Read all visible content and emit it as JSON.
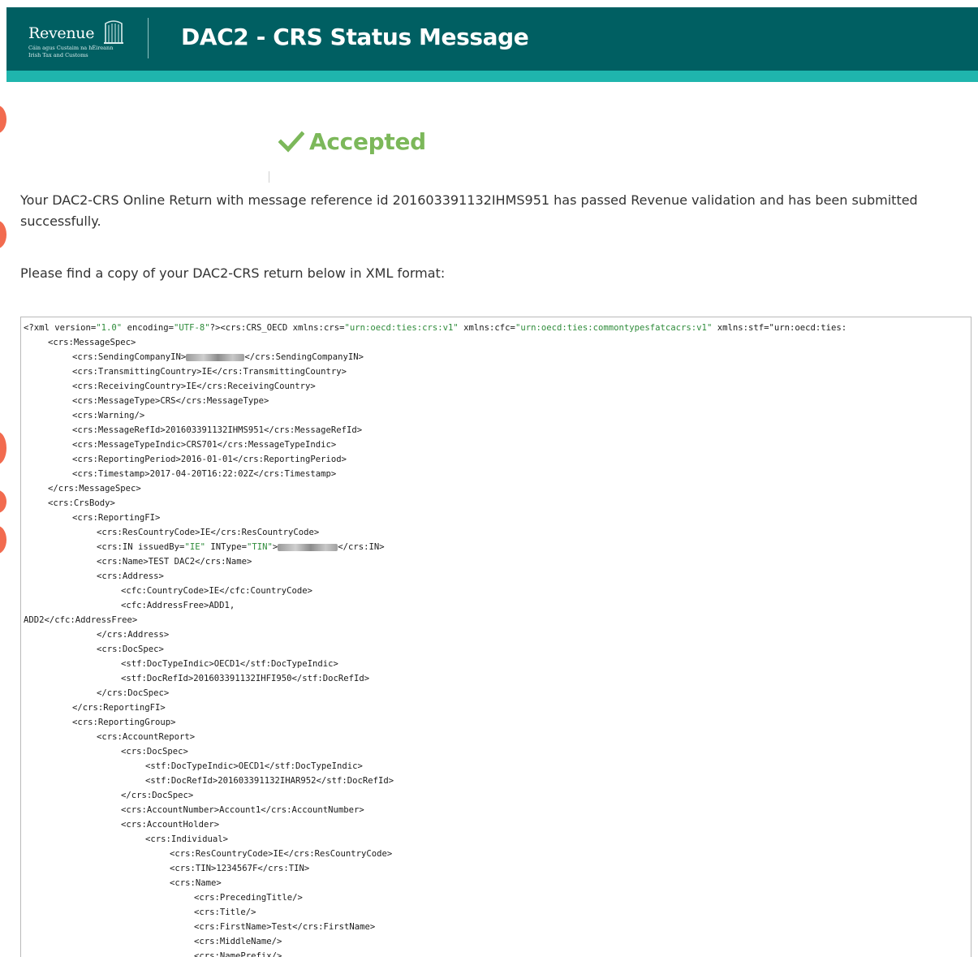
{
  "header": {
    "logo_text": "Revenue",
    "logo_subtitle_1": "Cáin agus Custaim na hÉireann",
    "logo_subtitle_2": "Irish Tax and Customs",
    "title": "DAC2 - CRS Status Message"
  },
  "status": {
    "label": "Accepted",
    "icon": "check-icon",
    "color": "#7cb85a"
  },
  "message": {
    "text": "Your DAC2-CRS Online Return with message reference id 201603391132IHMS951 has passed Revenue validation and has been submitted successfully."
  },
  "instruction": {
    "text": "Please find a copy of your DAC2-CRS return below in XML format:"
  },
  "colors": {
    "header_bg": "#005f62",
    "header_accent": "#1fb5ad",
    "xml_string": "#2e8b3a"
  },
  "xml": {
    "lines": [
      {
        "indent": 0,
        "text": "<?xml version=\"1.0\" encoding=\"UTF-8\"?><crs:CRS_OECD xmlns:crs=\"urn:oecd:ties:crs:v1\" xmlns:cfc=\"urn:oecd:ties:commontypesfatcacrs:v1\" xmlns:stf=\"urn:oecd:ties:"
      },
      {
        "indent": 1,
        "text": "<crs:MessageSpec>"
      },
      {
        "indent": 2,
        "text": "<crs:SendingCompanyIN>",
        "redacted": true,
        "redact_width": 72,
        "after": "</crs:SendingCompanyIN>"
      },
      {
        "indent": 2,
        "text": "<crs:TransmittingCountry>IE</crs:TransmittingCountry>"
      },
      {
        "indent": 2,
        "text": "<crs:ReceivingCountry>IE</crs:ReceivingCountry>"
      },
      {
        "indent": 2,
        "text": "<crs:MessageType>CRS</crs:MessageType>"
      },
      {
        "indent": 2,
        "text": "<crs:Warning/>"
      },
      {
        "indent": 2,
        "text": "<crs:MessageRefId>201603391132IHMS951</crs:MessageRefId>"
      },
      {
        "indent": 2,
        "text": "<crs:MessageTypeIndic>CRS701</crs:MessageTypeIndic>"
      },
      {
        "indent": 2,
        "text": "<crs:ReportingPeriod>2016-01-01</crs:ReportingPeriod>"
      },
      {
        "indent": 2,
        "text": "<crs:Timestamp>2017-04-20T16:22:02Z</crs:Timestamp>"
      },
      {
        "indent": 1,
        "text": "</crs:MessageSpec>"
      },
      {
        "indent": 1,
        "text": "<crs:CrsBody>"
      },
      {
        "indent": 2,
        "text": "<crs:ReportingFI>"
      },
      {
        "indent": 3,
        "text": "<crs:ResCountryCode>IE</crs:ResCountryCode>"
      },
      {
        "indent": 3,
        "text": "<crs:IN issuedBy=\"IE\" INType=\"TIN\">",
        "redacted": true,
        "redact_width": 74,
        "after": "</crs:IN>"
      },
      {
        "indent": 3,
        "text": "<crs:Name>TEST DAC2</crs:Name>"
      },
      {
        "indent": 3,
        "text": "<crs:Address>"
      },
      {
        "indent": 4,
        "text": "<cfc:CountryCode>IE</cfc:CountryCode>"
      },
      {
        "indent": 4,
        "text": "<cfc:AddressFree>ADD1,"
      },
      {
        "indent": 0,
        "text": "ADD2</cfc:AddressFree>"
      },
      {
        "indent": 3,
        "text": "</crs:Address>"
      },
      {
        "indent": 3,
        "text": "<crs:DocSpec>"
      },
      {
        "indent": 4,
        "text": "<stf:DocTypeIndic>OECD1</stf:DocTypeIndic>"
      },
      {
        "indent": 4,
        "text": "<stf:DocRefId>201603391132IHFI950</stf:DocRefId>"
      },
      {
        "indent": 3,
        "text": "</crs:DocSpec>"
      },
      {
        "indent": 2,
        "text": "</crs:ReportingFI>"
      },
      {
        "indent": 2,
        "text": "<crs:ReportingGroup>"
      },
      {
        "indent": 3,
        "text": "<crs:AccountReport>"
      },
      {
        "indent": 4,
        "text": "<crs:DocSpec>"
      },
      {
        "indent": 5,
        "text": "<stf:DocTypeIndic>OECD1</stf:DocTypeIndic>"
      },
      {
        "indent": 5,
        "text": "<stf:DocRefId>201603391132IHAR952</stf:DocRefId>"
      },
      {
        "indent": 4,
        "text": "</crs:DocSpec>"
      },
      {
        "indent": 4,
        "text": "<crs:AccountNumber>Account1</crs:AccountNumber>"
      },
      {
        "indent": 4,
        "text": "<crs:AccountHolder>"
      },
      {
        "indent": 5,
        "text": "<crs:Individual>"
      },
      {
        "indent": 6,
        "text": "<crs:ResCountryCode>IE</crs:ResCountryCode>"
      },
      {
        "indent": 6,
        "text": "<crs:TIN>1234567F</crs:TIN>"
      },
      {
        "indent": 6,
        "text": "<crs:Name>"
      },
      {
        "indent": 7,
        "text": "<crs:PrecedingTitle/>"
      },
      {
        "indent": 7,
        "text": "<crs:Title/>"
      },
      {
        "indent": 7,
        "text": "<crs:FirstName>Test</crs:FirstName>"
      },
      {
        "indent": 7,
        "text": "<crs:MiddleName/>"
      },
      {
        "indent": 7,
        "text": "<crs:NamePrefix/>"
      }
    ]
  }
}
